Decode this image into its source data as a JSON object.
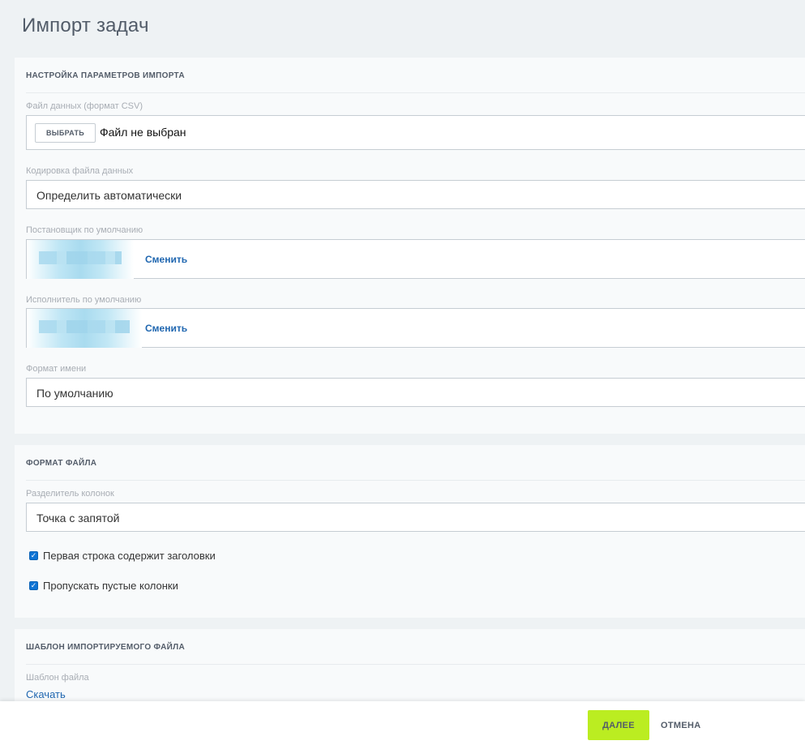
{
  "header": {
    "title": "Импорт задач"
  },
  "import_settings": {
    "section_title": "Настройка параметров импорта",
    "data_file": {
      "label": "Файл данных (формат CSV)",
      "choose_label": "Выбрать",
      "status": "Файл не выбран"
    },
    "encoding": {
      "label": "Кодировка файла данных",
      "value": "Определить автоматически"
    },
    "default_creator": {
      "label": "Постановщик по умолчанию",
      "change_label": "Сменить"
    },
    "default_responsible": {
      "label": "Исполнитель по умолчанию",
      "change_label": "Сменить"
    },
    "name_format": {
      "label": "Формат имени",
      "value": "По умолчанию"
    }
  },
  "file_format": {
    "section_title": "Формат файла",
    "separator": {
      "label": "Разделитель колонок",
      "value": "Точка с запятой"
    },
    "first_row_headers": {
      "label": "Первая строка содержит заголовки",
      "checked": true
    },
    "skip_empty_columns": {
      "label": "Пропускать пустые колонки",
      "checked": true
    }
  },
  "template": {
    "section_title": "Шаблон импортируемого файла",
    "file_template_label": "Шаблон файла",
    "download_label": "Скачать"
  },
  "footer": {
    "next_label": "Далее",
    "cancel_label": "Отмена"
  },
  "colors": {
    "accent_green": "#bbed21",
    "link_blue": "#2067b0",
    "checkbox_blue": "#0f74d4"
  }
}
